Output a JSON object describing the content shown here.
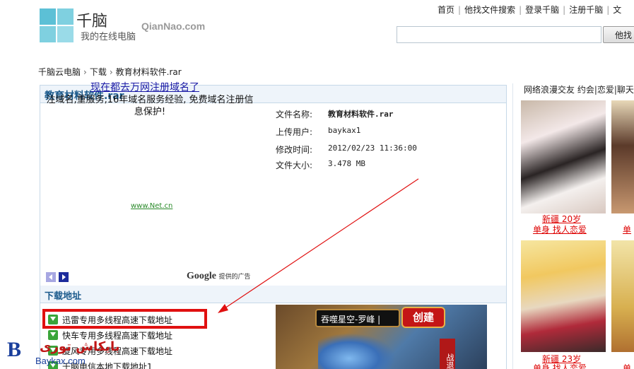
{
  "header": {
    "logo_name": "千脑",
    "logo_tagline": "我的在线电脑",
    "site_domain": "QianNao.com",
    "nav": [
      "首页",
      "他找文件搜索",
      "登录千脑",
      "注册千脑",
      "文"
    ],
    "search": {
      "value": "",
      "button_label": "他找"
    }
  },
  "breadcrumb": [
    "千脑云电脑",
    "下载",
    "教育材料软件.rar"
  ],
  "file_panel": {
    "title": "教育材料软件.rar",
    "info": [
      {
        "label": "文件名称:",
        "value": "教育材料软件.rar",
        "bold": true
      },
      {
        "label": "上传用户:",
        "value": "baykax1"
      },
      {
        "label": "修改时间:",
        "value": "2012/02/23 11:36:00"
      },
      {
        "label": "文件大小:",
        "value": "3.478 MB"
      }
    ]
  },
  "ad": {
    "headline": "现在都去万网注册域名了",
    "body": "注域名,重服务,16年域名服务经验, 免费域名注册信息保护!",
    "url": "www.Net.cn",
    "google_label": "Google",
    "google_suffix": "提供的广告"
  },
  "download": {
    "heading": "下载地址",
    "links": [
      "迅雷专用多线程高速下载地址",
      "快车专用多线程高速下载地址",
      "旋风专用多线程高速下载地址",
      "千脑电信本地下载地址1"
    ]
  },
  "game_banner": {
    "input_text": "吞噬星空-罗峰 |",
    "button": "创建",
    "side_text": "战退"
  },
  "sidebar": {
    "heading": "网络浪漫交友 约会|恋爱|聊天",
    "profiles": [
      {
        "line1": "新疆  20岁",
        "line2": "单身  找人恋爱"
      },
      {
        "line1": "",
        "line2": "单"
      },
      {
        "line1": "新疆  23岁",
        "line2": "单身  找人恋爱"
      },
      {
        "line1": "",
        "line2": "单"
      }
    ]
  },
  "watermark": {
    "logo_letter": "B",
    "arabic": "بایکاش توری",
    "url": "Baykax.com"
  },
  "colors": {
    "panel_border": "#c6d8e8",
    "panel_title": "#1b5a8c",
    "annotation_red": "#e01010",
    "link_blue": "#1a1aa6",
    "profile_red": "#d00000"
  }
}
